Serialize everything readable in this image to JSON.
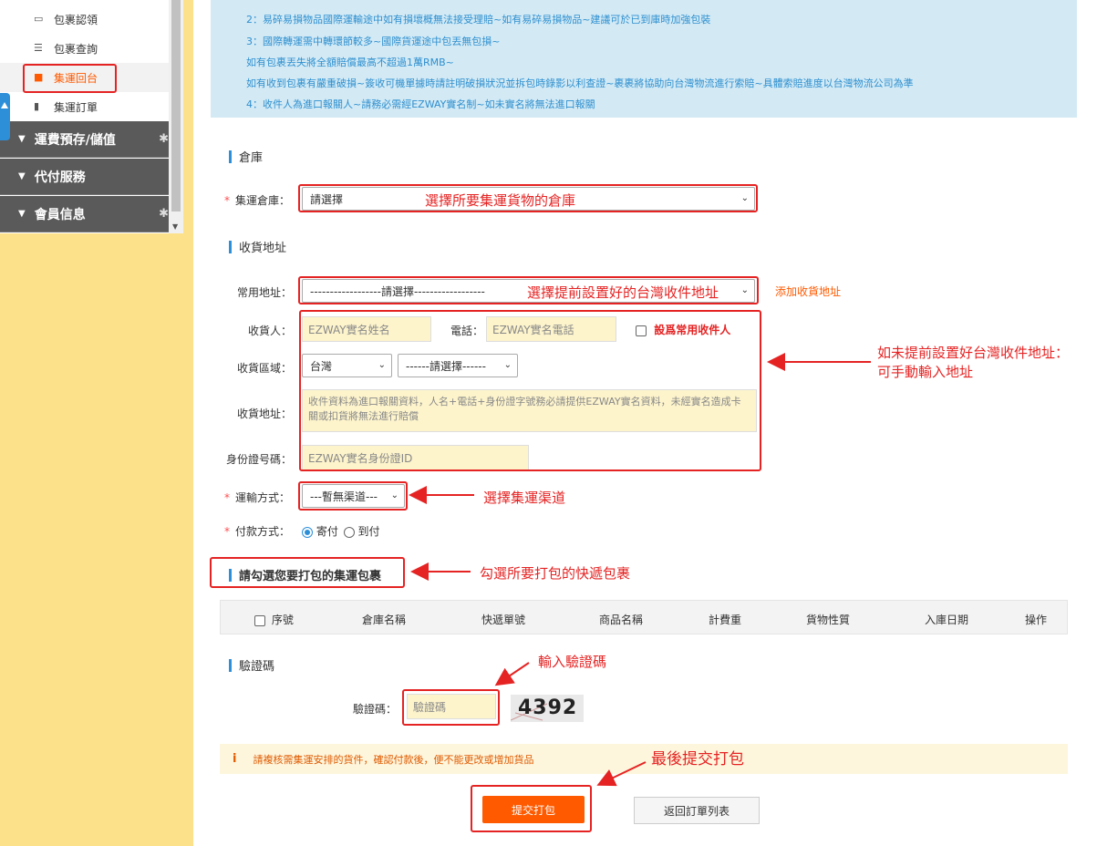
{
  "sidebar": {
    "sub_items": [
      {
        "label": "包裹認領",
        "icon": "inbox-icon"
      },
      {
        "label": "包裹查詢",
        "icon": "list-icon"
      },
      {
        "label": "集運回台",
        "icon": "truck-icon"
      },
      {
        "label": "集運訂單",
        "icon": "book-icon"
      }
    ],
    "groups": [
      {
        "label": "運費預存/儲值"
      },
      {
        "label": "代付服務"
      },
      {
        "label": "會員信息"
      }
    ]
  },
  "notice": {
    "lines": [
      "2：易碎易損物品國際運輸途中如有損壞概無法接受理賠~如有易碎易損物品~建議可於已到庫時加強包裝",
      "3：國際轉運需中轉環節較多~國際貨運途中包丟無包損~",
      "如有包裹丟失將全額賠償最高不超過1萬RMB~",
      "如有收到包裹有嚴重破損~簽收可機單據時請註明破損狀況並拆包時錄影以利查證~裹裹將協助向台灣物流進行索賠~具體索賠進度以台灣物流公司為準",
      "4：收件人為進口報關人~請務必需經EZWAY實名制~如未實名將無法進口報關"
    ]
  },
  "warehouse": {
    "section_title": "倉庫",
    "label": "集運倉庫：",
    "value": "請選擇"
  },
  "address": {
    "section_title": "收貨地址",
    "common_label": "常用地址：",
    "common_value": "------------------請選擇------------------",
    "add_link": "添加收貨地址",
    "recipient_label": "收貨人：",
    "recipient_placeholder": "EZWAY實名姓名",
    "phone_label": "電話：",
    "phone_placeholder": "EZWAY實名電話",
    "set_common_label": "設爲常用收件人",
    "region_label": "收貨區域：",
    "region_country": "台灣",
    "region_city": "------請選擇------",
    "address_label": "收貨地址：",
    "address_placeholder": "收件資料為進口報關資料，人名+電話+身份證字號務必請提供EZWAY實名資料，未經實名造成卡關或扣貨將無法進行賠償",
    "id_label": "身份證号碼：",
    "id_placeholder": "EZWAY實名身份證ID"
  },
  "shipping": {
    "label": "運輸方式：",
    "value": "---暫無渠道---"
  },
  "payment": {
    "label": "付款方式：",
    "option_1": "寄付",
    "option_2": "到付"
  },
  "packages": {
    "section_title": "請勾選您要打包的集運包裹",
    "columns": [
      "序號",
      "倉庫名稱",
      "快遞單號",
      "商品名稱",
      "計費重",
      "貨物性質",
      "入庫日期",
      "操作"
    ]
  },
  "captcha": {
    "section_title": "驗證碼",
    "label": "驗證碼：",
    "placeholder": "驗證碼",
    "image_text": "4392"
  },
  "warning": "請複核需集運安排的貨件，確認付款後，便不能更改或增加貨品",
  "buttons": {
    "submit": "提交打包",
    "back": "返回訂單列表"
  },
  "annotations": {
    "warehouse": "選擇所要集運貨物的倉庫",
    "common_address": "選擇提前設置好的台灣收件地址",
    "manual_line1": "如未提前設置好台灣收件地址：",
    "manual_line2": "可手動輸入地址",
    "shipping": "選擇集運渠道",
    "packages": "勾選所要打包的快遞包裹",
    "captcha": "輸入驗證碼",
    "submit": "最後提交打包"
  },
  "colors": {
    "accent": "#ff5a00",
    "annotation_red": "#e52323",
    "notice_blue": "#2e8fcf",
    "sidebar_dark": "#5a5a5a",
    "band_yellow": "#fde18a"
  }
}
